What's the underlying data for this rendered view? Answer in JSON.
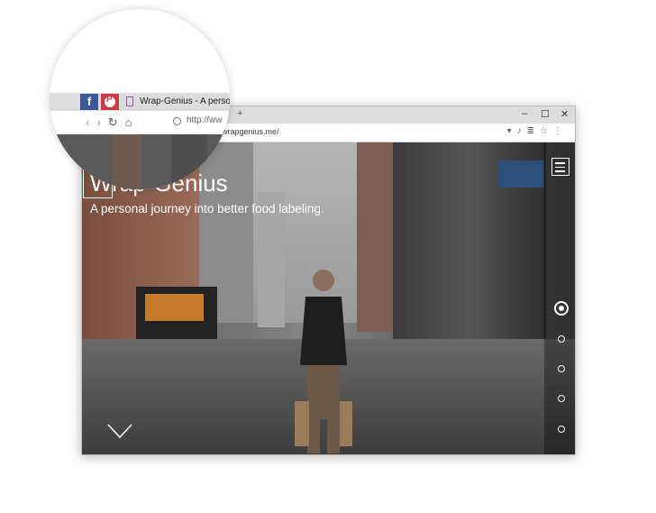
{
  "browser": {
    "tab_title": "Wrap-Genius - A perso",
    "new_tab": "+",
    "window_controls": [
      "–",
      "☐",
      "✕"
    ],
    "url_partial": "http://ww",
    "url": "wrapgenius.me/",
    "nav_icons": [
      "back-icon",
      "forward-icon",
      "reload-icon",
      "home-icon",
      "info-icon"
    ],
    "address_icons": [
      "dropdown-icon",
      "mic-icon",
      "reader-icon",
      "star-icon",
      "more-icon"
    ]
  },
  "social": {
    "facebook": "f",
    "pinterest": "P",
    "colors": {
      "facebook": "#3b5998",
      "pinterest": "#cc3a45"
    }
  },
  "site": {
    "logo": "Wrap-Genius",
    "tagline": "A personal journey into better food labeling.",
    "page_dots": 5,
    "active_dot": 0
  }
}
